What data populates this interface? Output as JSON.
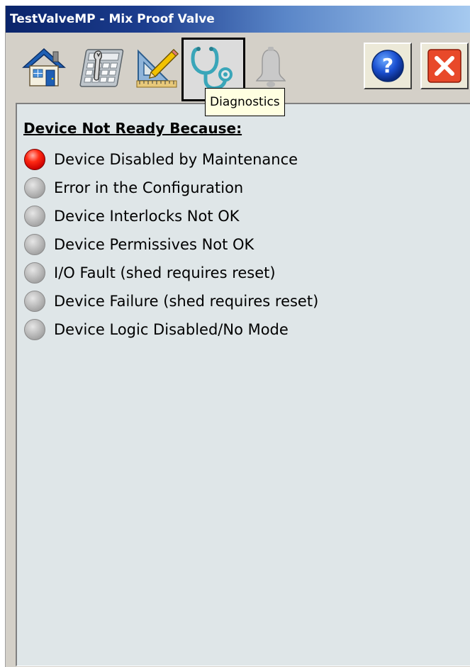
{
  "window": {
    "title": "TestValveMP - Mix Proof Valve"
  },
  "toolbar": {
    "buttons": [
      {
        "id": "home",
        "icon": "home-icon"
      },
      {
        "id": "configuration",
        "icon": "calculator-wrench-icon"
      },
      {
        "id": "engineering",
        "icon": "ruler-pencil-icon"
      },
      {
        "id": "diagnostics",
        "icon": "stethoscope-icon",
        "selected": true
      },
      {
        "id": "alarms",
        "icon": "bell-icon",
        "enabled": false
      },
      {
        "id": "help",
        "icon": "question-icon"
      },
      {
        "id": "close",
        "icon": "close-icon"
      }
    ],
    "tooltip": "Diagnostics"
  },
  "panel": {
    "heading": "Device Not Ready Because:",
    "reasons": [
      {
        "label": "Device Disabled by Maintenance",
        "active": true
      },
      {
        "label": "Error in the Configuration",
        "active": false
      },
      {
        "label": "Device Interlocks Not OK",
        "active": false
      },
      {
        "label": "Device Permissives Not OK",
        "active": false
      },
      {
        "label": "I/O Fault (shed requires reset)",
        "active": false
      },
      {
        "label": "Device Failure (shed requires reset)",
        "active": false
      },
      {
        "label": "Device Logic Disabled/No Mode",
        "active": false
      }
    ]
  },
  "colors": {
    "titlebar_start": "#0a246a",
    "titlebar_end": "#a6caf0",
    "panel_background": "#dfe6e8",
    "indicator_active": "#ff2a14",
    "indicator_inactive": "#b4b4b4"
  }
}
